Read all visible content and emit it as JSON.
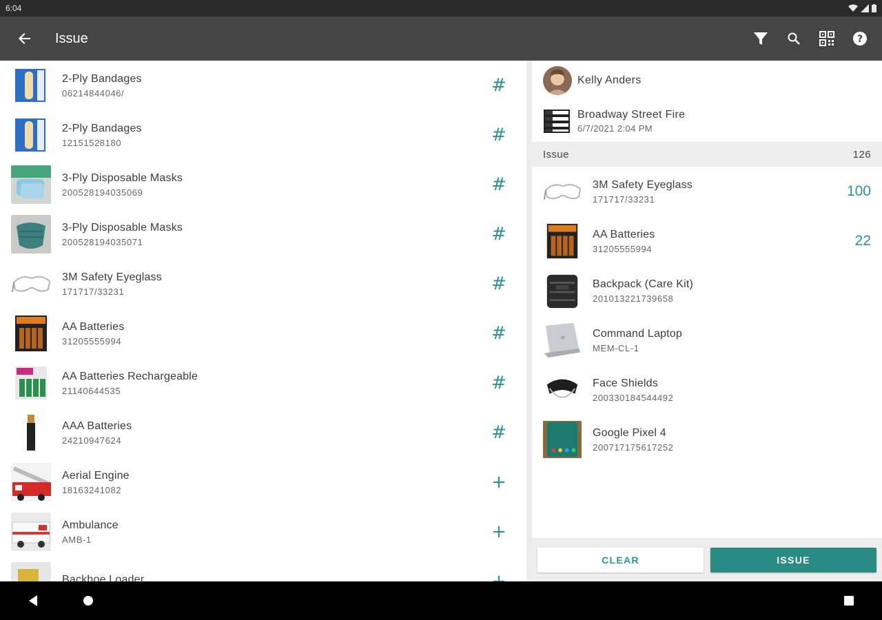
{
  "status_bar": {
    "time": "6:04"
  },
  "app_bar": {
    "title": "Issue"
  },
  "inventory": [
    {
      "name": "2-Ply Bandages",
      "code": "06214844046/",
      "action": "#",
      "thumb": "bandage-image"
    },
    {
      "name": "2-Ply Bandages",
      "code": "12151528180",
      "action": "#",
      "thumb": "bandage-image"
    },
    {
      "name": "3-Ply Disposable Masks",
      "code": "200528194035069",
      "action": "#",
      "thumb": "mask-box-image"
    },
    {
      "name": "3-Ply Disposable Masks",
      "code": "200528194035071",
      "action": "#",
      "thumb": "mask-image"
    },
    {
      "name": "3M Safety Eyeglass",
      "code": "171717/33231",
      "action": "#",
      "thumb": "eyeglass-image"
    },
    {
      "name": "AA Batteries",
      "code": "31205555994",
      "action": "#",
      "thumb": "batteries-image"
    },
    {
      "name": "AA Batteries Rechargeable",
      "code": "21140644535",
      "action": "#",
      "thumb": "rechargeable-batteries-image"
    },
    {
      "name": "AAA Batteries",
      "code": "24210947624",
      "action": "#",
      "thumb": "aaa-battery-image"
    },
    {
      "name": "Aerial Engine",
      "code": "18163241082",
      "action": "+",
      "thumb": "aerial-engine-image"
    },
    {
      "name": "Ambulance",
      "code": "AMB-1",
      "action": "+",
      "thumb": "ambulance-image"
    },
    {
      "name": "Backhoe Loader",
      "code": "",
      "action": "+",
      "thumb": "backhoe-image"
    }
  ],
  "assignee": {
    "name": "Kelly Anders"
  },
  "incident": {
    "name": "Broadway Street Fire",
    "date": "6/7/2021 2:04 PM"
  },
  "issue_section": {
    "label": "Issue",
    "count": "126"
  },
  "cart": [
    {
      "name": "3M Safety Eyeglass",
      "code": "171717/33231",
      "qty": "100",
      "thumb": "eyeglass-image"
    },
    {
      "name": "AA Batteries",
      "code": "31205555994",
      "qty": "22",
      "thumb": "batteries-image"
    },
    {
      "name": "Backpack (Care Kit)",
      "code": "201013221739658",
      "qty": "",
      "thumb": "backpack-image"
    },
    {
      "name": "Command Laptop",
      "code": "MEM-CL-1",
      "qty": "",
      "thumb": "laptop-image"
    },
    {
      "name": "Face Shields",
      "code": "200330184544492",
      "qty": "",
      "thumb": "face-shield-image"
    },
    {
      "name": "Google Pixel 4",
      "code": "200717175617252",
      "qty": "",
      "thumb": "phone-image"
    }
  ],
  "buttons": {
    "clear": "CLEAR",
    "issue": "ISSUE"
  },
  "colors": {
    "accent": "#2a9590",
    "appbar": "#454545",
    "primary_button": "#2a8a84"
  }
}
